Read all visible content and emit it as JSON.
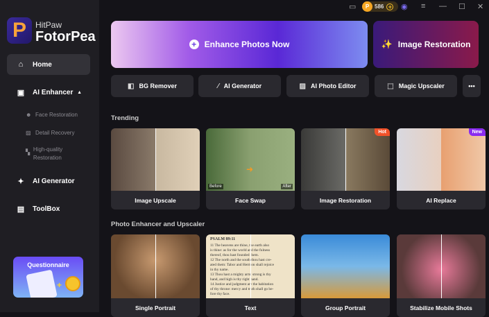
{
  "app": {
    "brand_top": "HitPaw",
    "brand_name": "FotorPea",
    "logo_letter": "P"
  },
  "topbar": {
    "coins": "586",
    "icons": [
      "screen-icon",
      "coin-icon",
      "add-coins-icon",
      "account-icon",
      "menu-icon",
      "minimize-icon",
      "maximize-icon",
      "close-icon"
    ]
  },
  "sidebar": {
    "home": "Home",
    "ai_enhancer": "AI Enhancer",
    "sub": [
      "Face Restoration",
      "Detail Recovery",
      "High-quality Restoration"
    ],
    "ai_generator": "AI Generator",
    "toolbox": "ToolBox",
    "questionnaire": "Questionnaire"
  },
  "hero": {
    "enhance": "Enhance Photos Now",
    "restoration": "Image Restoration"
  },
  "tools": [
    "BG Remover",
    "AI Generator",
    "AI Photo Editor",
    "Magic Upscaler"
  ],
  "more": "•••",
  "trending": {
    "title": "Trending",
    "cards": [
      {
        "label": "Image Upscale"
      },
      {
        "label": "Face Swap",
        "before": "Before",
        "after": "After"
      },
      {
        "label": "Image Restoration",
        "badge": "Hot"
      },
      {
        "label": "AI Replace",
        "badge": "New"
      }
    ]
  },
  "enhancer": {
    "title": "Photo Enhancer and Upscaler",
    "cards": [
      "Single Portrait",
      "Text",
      "Group Portrait",
      "Stabilize Mobile Shots"
    ]
  },
  "psalm": {
    "header": "PSALM 89:11",
    "lines": [
      "11 The heavens are thine, the earth also",
      "is thine: as for the world and the fulness",
      "thereof, thou hast founded them.",
      "12 The north and the south thou hast cre-",
      "ated them: Tabor and Hermon shall rejoice",
      "in thy name.",
      "13 Thou hast a mighty arm: strong is thy",
      "hand, and high is thy right hand.",
      "14 Justice and judgment are the habitation",
      "of thy throne: mercy and truth shall go be-",
      "fore thy face."
    ]
  },
  "colors": {
    "hot": "#f0522a",
    "new": "#8a2cf0",
    "accent": "#6a3ee0"
  }
}
